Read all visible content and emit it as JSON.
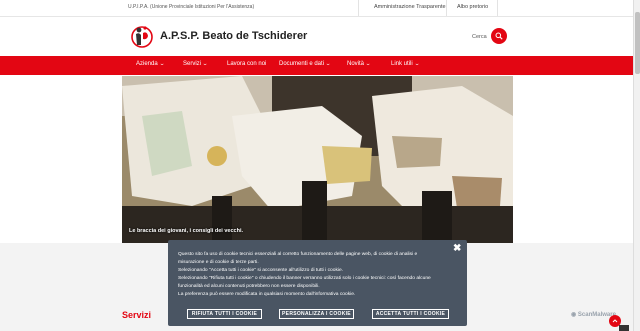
{
  "topbar": {
    "upipa": "U.P.I.P.A. (Unione Provinciale Istituzioni Per l'Assistenza)",
    "links": [
      "Amministrazione Trasparente",
      "Albo pretorio"
    ]
  },
  "header": {
    "title": "A.P.S.P. Beato de Tschiderer",
    "search_label": "Cerca"
  },
  "nav": [
    {
      "label": "Azienda",
      "has_dropdown": true
    },
    {
      "label": "Servizi",
      "has_dropdown": true
    },
    {
      "label": "Lavora con noi",
      "has_dropdown": false
    },
    {
      "label": "Documenti e dati",
      "has_dropdown": true
    },
    {
      "label": "Novità",
      "has_dropdown": true
    },
    {
      "label": "Link utili",
      "has_dropdown": true
    }
  ],
  "hero": {
    "caption": "Le braccia dei giovani, i consigli dei vecchi."
  },
  "sections": {
    "servizi_title": "Servizi"
  },
  "cookie": {
    "lines": [
      "Questo sito fa uso di cookie tecnici essenziali al corretto funzionamento delle pagine web, di cookie di analisi e",
      "misurazione e di cookie di terze parti.",
      "Selezionando \"Accetta tutti i cookie\" si acconsente all'utilizzo di tutti i cookie.",
      "Selezionando \"Rifiuta tutti i cookie\" o chiudendo il banner verranno utilizzati solo i cookie tecnici: così facendo alcune",
      "funzionalità ed alcuni contenuti potrebbero non essere disponibili.",
      "La preferenza può essere modificata in qualsiasi momento dall'informativa cookie."
    ],
    "buttons": {
      "reject": "RIFIUTA TUTTI I COOKIE",
      "customize": "PERSONALIZZA I COOKIE",
      "accept": "ACCETTA TUTTI I COOKIE"
    }
  },
  "badge": "ScanMalware",
  "colors": {
    "brand_red": "#e30613",
    "cookie_bg": "#4a5563"
  }
}
